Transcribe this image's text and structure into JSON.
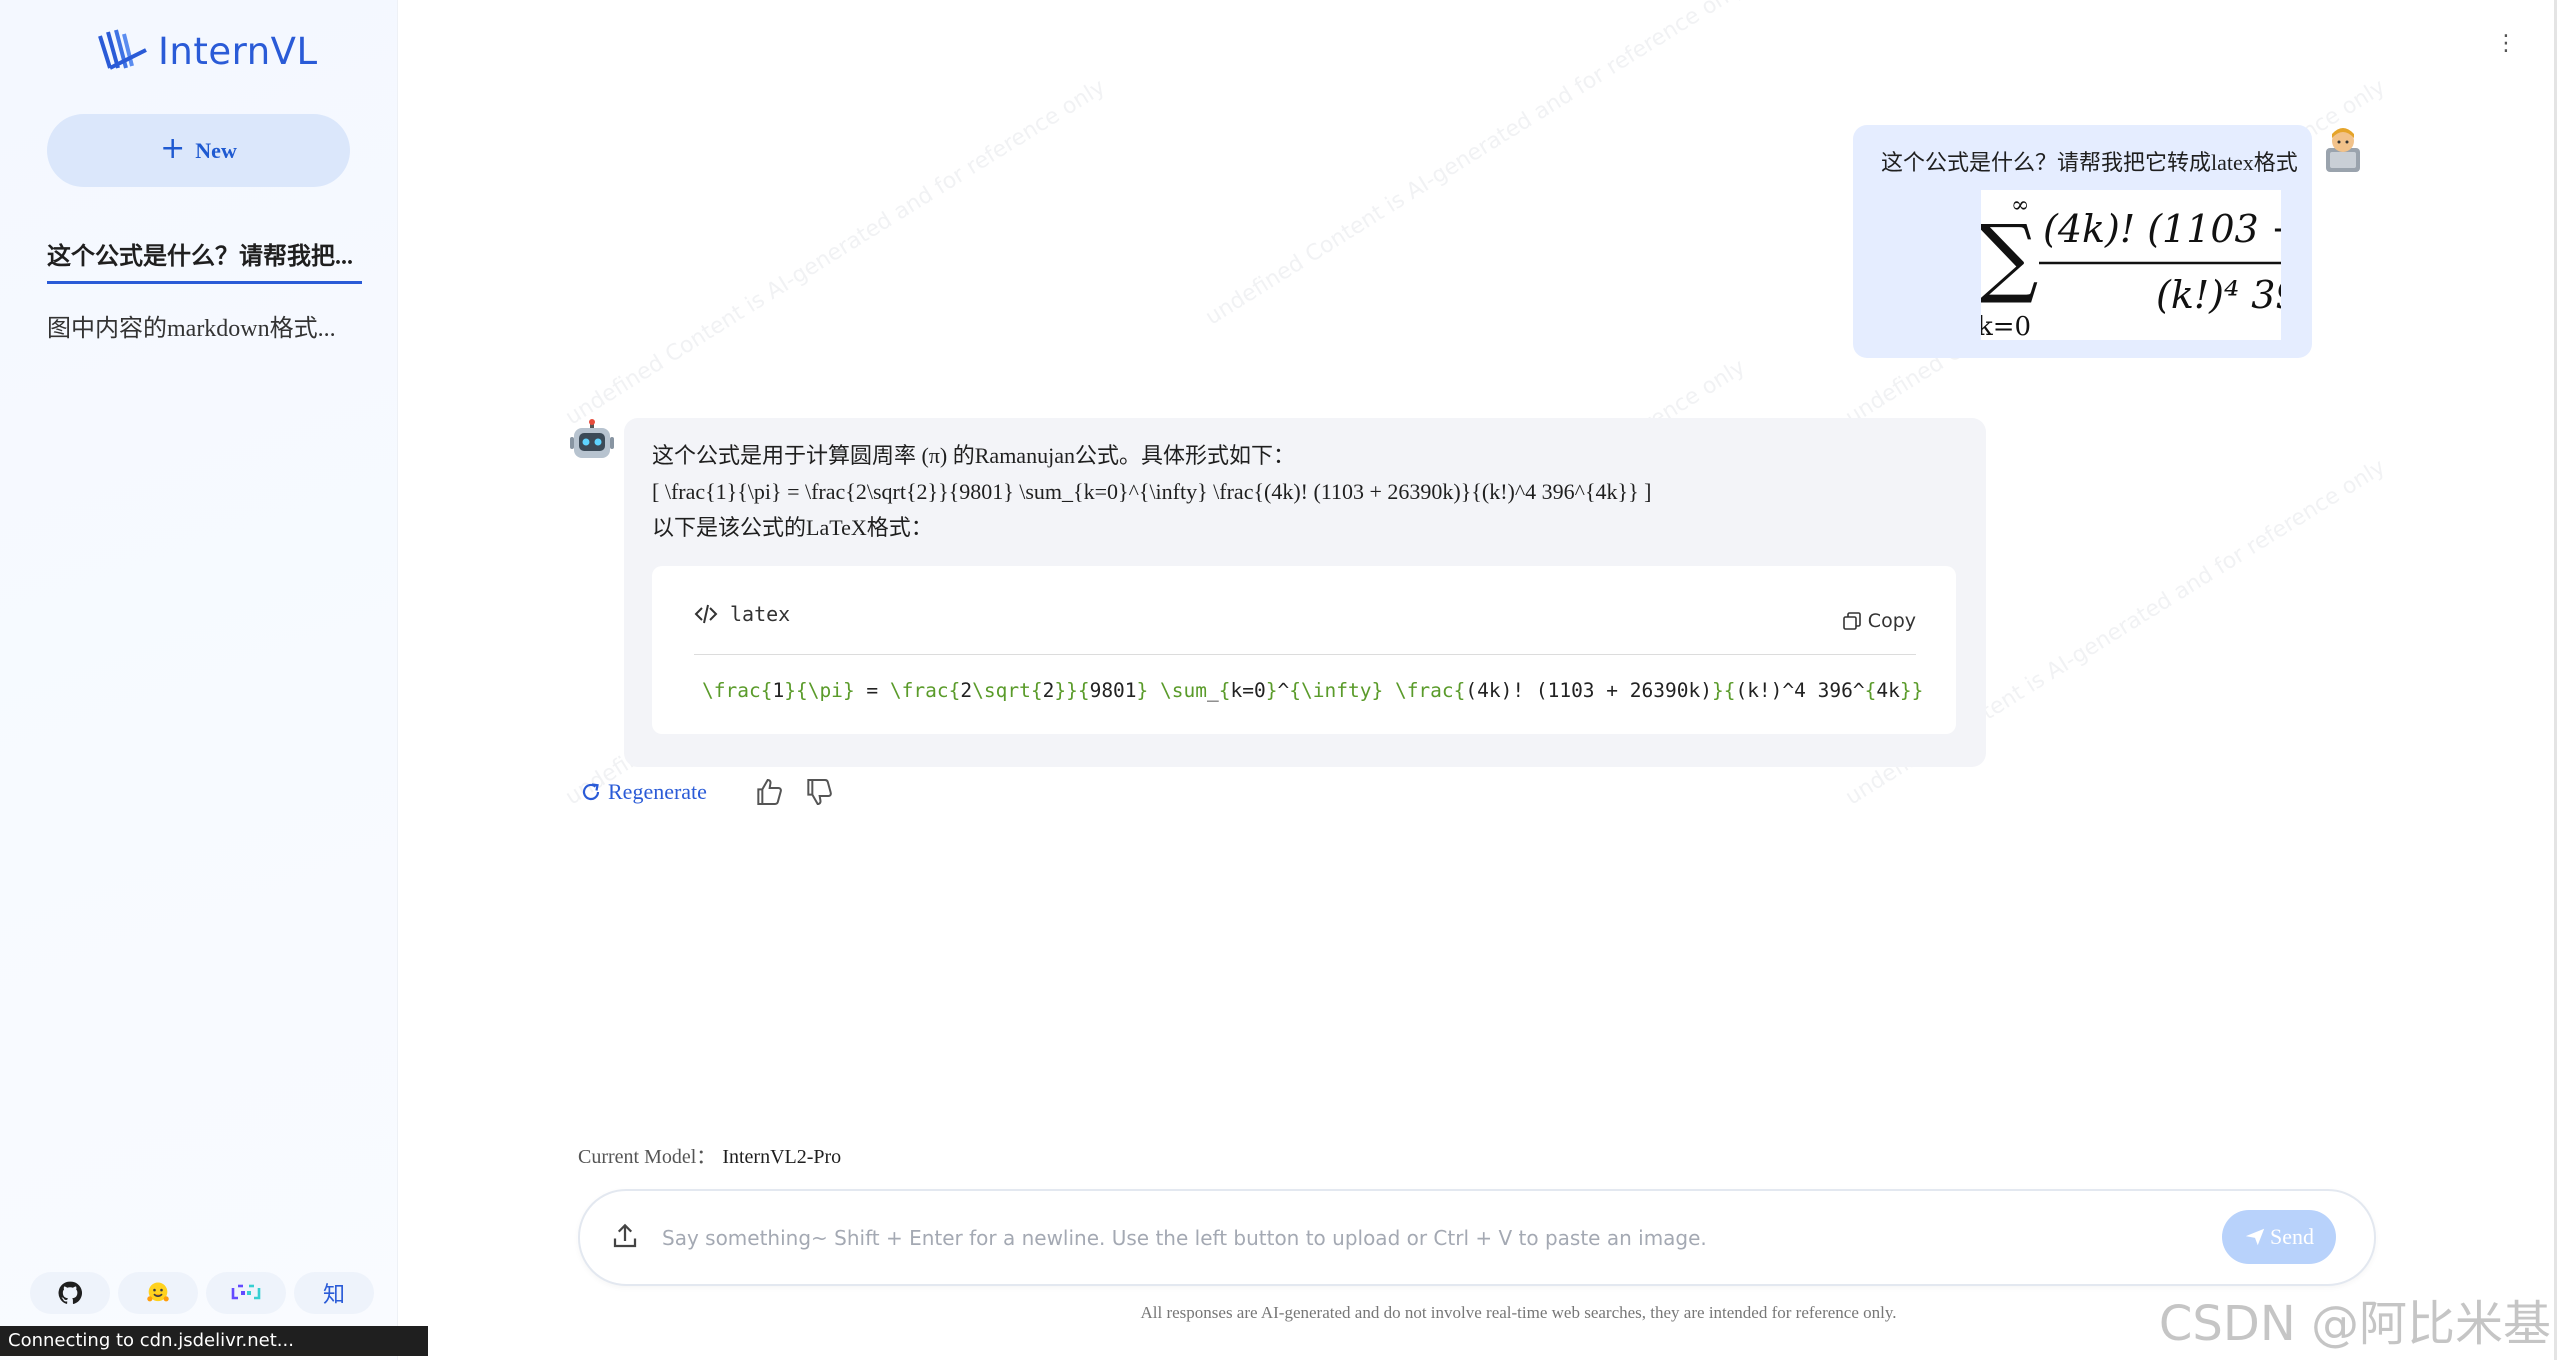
{
  "app": {
    "brand": "InternVL"
  },
  "sidebar": {
    "new_label": "New",
    "conversations": [
      {
        "title": "这个公式是什么？请帮我把...",
        "active": true
      },
      {
        "title": "图中内容的markdown格式...",
        "active": false
      }
    ],
    "links": [
      {
        "icon": "github-icon"
      },
      {
        "icon": "huggingface-icon"
      },
      {
        "icon": "modelscope-icon"
      },
      {
        "icon": "zhihu-icon",
        "label": "知"
      }
    ]
  },
  "status_bar": {
    "text": "Connecting to cdn.jsdelivr.net..."
  },
  "watermark": {
    "text": "undefined Content is AI-generated and for reference only"
  },
  "chat": {
    "user_message": {
      "text": "这个公式是什么？请帮我把它转成latex格式",
      "image_formula": {
        "top": "∞",
        "bottom": "k=0",
        "numerator": "(4k)! (1103 +",
        "denominator": "(k!)⁴ 39"
      }
    },
    "bot_message": {
      "lines": [
        "这个公式是用于计算圆周率 (π) 的Ramanujan公式。具体形式如下：",
        "[ \\frac{1}{\\pi} = \\frac{2\\sqrt{2}}{9801} \\sum_{k=0}^{\\infty} \\frac{(4k)! (1103 + 26390k)}{(k!)^4 396^{4k}} ]",
        "以下是该公式的LaTeX格式："
      ],
      "code": {
        "language": "latex",
        "copy_label": "Copy",
        "text": "\\frac{1}{\\pi} = \\frac{2\\sqrt{2}}{9801} \\sum_{k=0}^{\\infty} \\frac{(4k)! (1103 + 26390k)}{(k!)^4 396^{4k}}"
      }
    },
    "actions": {
      "regenerate_label": "Regenerate"
    }
  },
  "composer": {
    "model_label": "Current Model：",
    "model_name": "InternVL2-Pro",
    "placeholder": "Say something~ Shift + Enter for a newline. Use the left button to upload or Ctrl + V to paste an image.",
    "send_label": "Send",
    "disclaimer": "All responses are AI-generated and do not involve real-time web searches, they are intended for reference only."
  },
  "overlay": {
    "csdn_watermark": "CSDN @阿比米基"
  },
  "colors": {
    "accent": "#2a5bd7",
    "user_bubble": "#e5edff",
    "bot_bubble": "#f3f4f8",
    "code_keyword": "#5a9b2a"
  }
}
